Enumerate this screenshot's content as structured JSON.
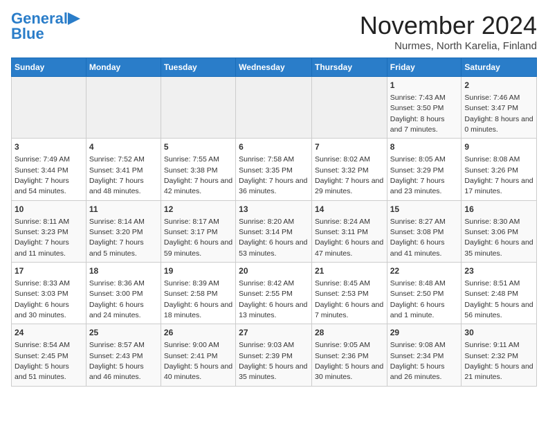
{
  "header": {
    "logo_general": "General",
    "logo_blue": "Blue",
    "title": "November 2024",
    "subtitle": "Nurmes, North Karelia, Finland"
  },
  "calendar": {
    "days_of_week": [
      "Sunday",
      "Monday",
      "Tuesday",
      "Wednesday",
      "Thursday",
      "Friday",
      "Saturday"
    ],
    "weeks": [
      [
        {
          "day": "",
          "info": ""
        },
        {
          "day": "",
          "info": ""
        },
        {
          "day": "",
          "info": ""
        },
        {
          "day": "",
          "info": ""
        },
        {
          "day": "",
          "info": ""
        },
        {
          "day": "1",
          "info": "Sunrise: 7:43 AM\nSunset: 3:50 PM\nDaylight: 8 hours and 7 minutes."
        },
        {
          "day": "2",
          "info": "Sunrise: 7:46 AM\nSunset: 3:47 PM\nDaylight: 8 hours and 0 minutes."
        }
      ],
      [
        {
          "day": "3",
          "info": "Sunrise: 7:49 AM\nSunset: 3:44 PM\nDaylight: 7 hours and 54 minutes."
        },
        {
          "day": "4",
          "info": "Sunrise: 7:52 AM\nSunset: 3:41 PM\nDaylight: 7 hours and 48 minutes."
        },
        {
          "day": "5",
          "info": "Sunrise: 7:55 AM\nSunset: 3:38 PM\nDaylight: 7 hours and 42 minutes."
        },
        {
          "day": "6",
          "info": "Sunrise: 7:58 AM\nSunset: 3:35 PM\nDaylight: 7 hours and 36 minutes."
        },
        {
          "day": "7",
          "info": "Sunrise: 8:02 AM\nSunset: 3:32 PM\nDaylight: 7 hours and 29 minutes."
        },
        {
          "day": "8",
          "info": "Sunrise: 8:05 AM\nSunset: 3:29 PM\nDaylight: 7 hours and 23 minutes."
        },
        {
          "day": "9",
          "info": "Sunrise: 8:08 AM\nSunset: 3:26 PM\nDaylight: 7 hours and 17 minutes."
        }
      ],
      [
        {
          "day": "10",
          "info": "Sunrise: 8:11 AM\nSunset: 3:23 PM\nDaylight: 7 hours and 11 minutes."
        },
        {
          "day": "11",
          "info": "Sunrise: 8:14 AM\nSunset: 3:20 PM\nDaylight: 7 hours and 5 minutes."
        },
        {
          "day": "12",
          "info": "Sunrise: 8:17 AM\nSunset: 3:17 PM\nDaylight: 6 hours and 59 minutes."
        },
        {
          "day": "13",
          "info": "Sunrise: 8:20 AM\nSunset: 3:14 PM\nDaylight: 6 hours and 53 minutes."
        },
        {
          "day": "14",
          "info": "Sunrise: 8:24 AM\nSunset: 3:11 PM\nDaylight: 6 hours and 47 minutes."
        },
        {
          "day": "15",
          "info": "Sunrise: 8:27 AM\nSunset: 3:08 PM\nDaylight: 6 hours and 41 minutes."
        },
        {
          "day": "16",
          "info": "Sunrise: 8:30 AM\nSunset: 3:06 PM\nDaylight: 6 hours and 35 minutes."
        }
      ],
      [
        {
          "day": "17",
          "info": "Sunrise: 8:33 AM\nSunset: 3:03 PM\nDaylight: 6 hours and 30 minutes."
        },
        {
          "day": "18",
          "info": "Sunrise: 8:36 AM\nSunset: 3:00 PM\nDaylight: 6 hours and 24 minutes."
        },
        {
          "day": "19",
          "info": "Sunrise: 8:39 AM\nSunset: 2:58 PM\nDaylight: 6 hours and 18 minutes."
        },
        {
          "day": "20",
          "info": "Sunrise: 8:42 AM\nSunset: 2:55 PM\nDaylight: 6 hours and 13 minutes."
        },
        {
          "day": "21",
          "info": "Sunrise: 8:45 AM\nSunset: 2:53 PM\nDaylight: 6 hours and 7 minutes."
        },
        {
          "day": "22",
          "info": "Sunrise: 8:48 AM\nSunset: 2:50 PM\nDaylight: 6 hours and 1 minute."
        },
        {
          "day": "23",
          "info": "Sunrise: 8:51 AM\nSunset: 2:48 PM\nDaylight: 5 hours and 56 minutes."
        }
      ],
      [
        {
          "day": "24",
          "info": "Sunrise: 8:54 AM\nSunset: 2:45 PM\nDaylight: 5 hours and 51 minutes."
        },
        {
          "day": "25",
          "info": "Sunrise: 8:57 AM\nSunset: 2:43 PM\nDaylight: 5 hours and 46 minutes."
        },
        {
          "day": "26",
          "info": "Sunrise: 9:00 AM\nSunset: 2:41 PM\nDaylight: 5 hours and 40 minutes."
        },
        {
          "day": "27",
          "info": "Sunrise: 9:03 AM\nSunset: 2:39 PM\nDaylight: 5 hours and 35 minutes."
        },
        {
          "day": "28",
          "info": "Sunrise: 9:05 AM\nSunset: 2:36 PM\nDaylight: 5 hours and 30 minutes."
        },
        {
          "day": "29",
          "info": "Sunrise: 9:08 AM\nSunset: 2:34 PM\nDaylight: 5 hours and 26 minutes."
        },
        {
          "day": "30",
          "info": "Sunrise: 9:11 AM\nSunset: 2:32 PM\nDaylight: 5 hours and 21 minutes."
        }
      ]
    ]
  }
}
